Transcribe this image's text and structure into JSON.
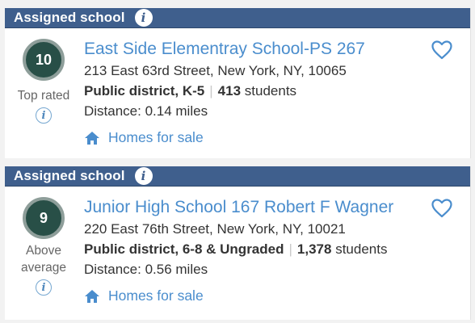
{
  "schools": [
    {
      "header": "Assigned school",
      "rating": "10",
      "rating_label": "Top rated",
      "name": "East Side Elementray School-PS 267",
      "address": "213 East 63rd Street, New York, NY, 10065",
      "type": "Public district, K-5",
      "students_count": "413",
      "students_word": "students",
      "distance": "Distance: 0.14 miles",
      "homes_link": "Homes for sale"
    },
    {
      "header": "Assigned school",
      "rating": "9",
      "rating_label": "Above average",
      "name": "Junior High School 167 Robert F Wagner",
      "address": "220 East 76th Street, New York, NY, 10021",
      "type": "Public district, 6-8 & Ungraded",
      "students_count": "1,378",
      "students_word": "students",
      "distance": "Distance: 0.56 miles",
      "homes_link": "Homes for sale"
    }
  ],
  "info_glyph": "i",
  "separator": "|",
  "colors": {
    "header_bg": "#3f5f8d",
    "link": "#4a8dcd",
    "rating_bg": "#284f47",
    "rating_ring": "#8e9e9a"
  },
  "icons": [
    "info-icon",
    "home-icon",
    "heart-icon"
  ]
}
